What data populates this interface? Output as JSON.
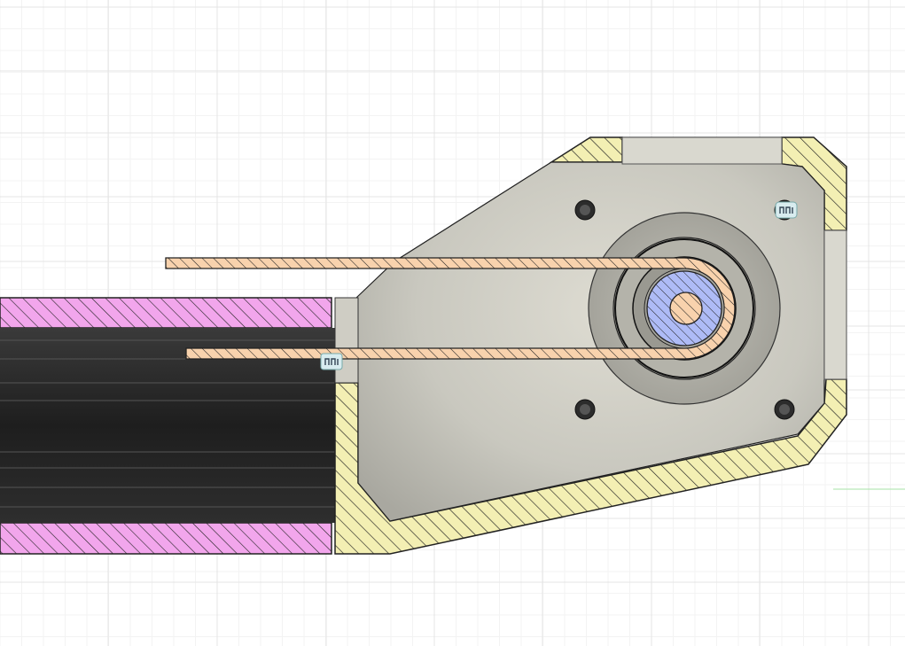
{
  "canvas": {
    "background": "#ffffff",
    "grid_color": "#e4e4e4",
    "axis_color": "#b6e7b6"
  },
  "materials": {
    "housing_hatch": "#f3efb3",
    "tube_hatch": "#f2a6ec",
    "belt_hatch": "#f8d2ad",
    "pulley_hatch": "#aebbf6",
    "shaft_hatch": "#f8d2ad",
    "plate_fill": "#c9c8bf",
    "tube_interior": "#2a2a2a"
  },
  "icons": {
    "joint_icon_top_right": "joint-icon",
    "joint_icon_belt": "joint-icon"
  }
}
